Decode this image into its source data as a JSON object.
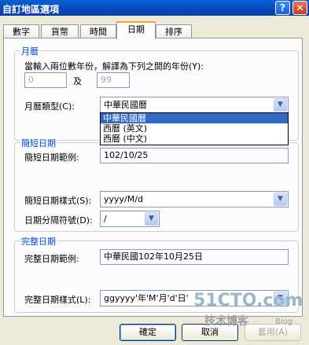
{
  "window": {
    "title": "自訂地區選項",
    "help": "?",
    "close": "✕"
  },
  "tabs": [
    "數字",
    "貨幣",
    "時間",
    "日期",
    "排序"
  ],
  "calendar": {
    "group_title": "月曆",
    "range_label": "當輸入兩位數年份，解譯為下列之間的年份(Y):",
    "from_year": "0",
    "and_label": "及",
    "to_year": "99",
    "type_label": "月曆類型(C):",
    "type_value": "中華民國曆",
    "options": [
      "中華民國曆",
      "西曆 (英文)",
      "西曆 (中文)"
    ]
  },
  "short_date": {
    "group_title": "簡短日期",
    "sample_label": "簡短日期範例:",
    "sample_value": "102/10/25",
    "style_label": "簡短日期樣式(S):",
    "style_value": "yyyy/M/d",
    "sep_label": "日期分隔符號(D):",
    "sep_value": "/"
  },
  "long_date": {
    "group_title": "完整日期",
    "sample_label": "完整日期範例:",
    "sample_value": "中華民國102年10月25日",
    "style_label": "完整日期樣式(L):",
    "style_value": "ggyyyy'年'M'月'd'日'"
  },
  "buttons": {
    "ok": "確定",
    "cancel": "取消",
    "apply": "套用(A)"
  },
  "watermark": {
    "line1": "51CTO.com",
    "line2": "技术博客",
    "line3": "Blog"
  }
}
